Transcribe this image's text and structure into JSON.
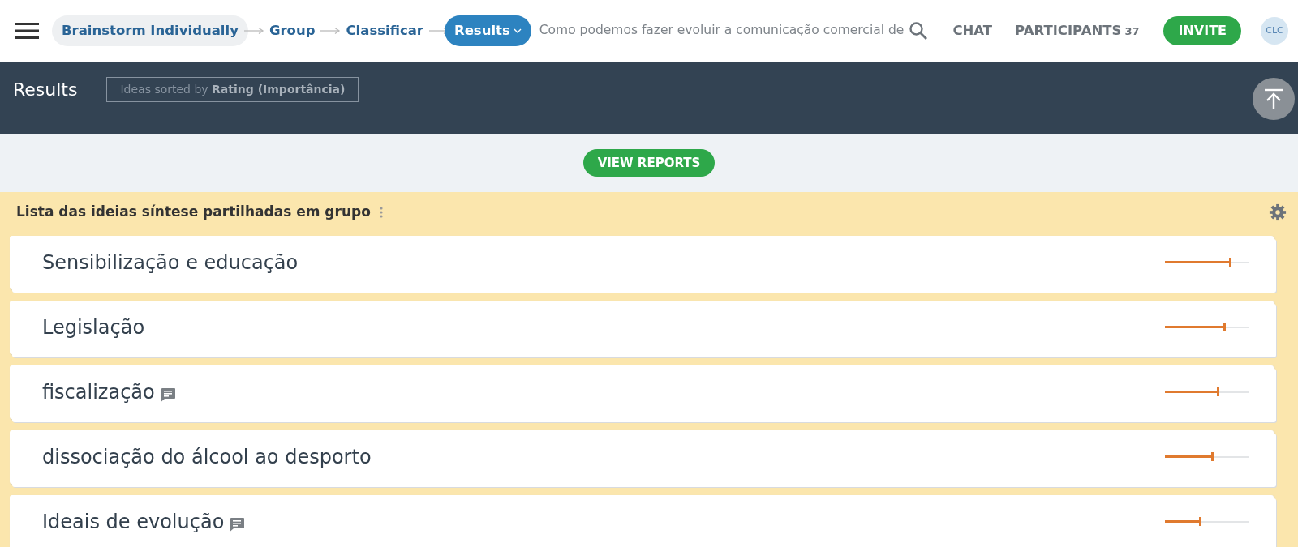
{
  "breadcrumb": [
    {
      "label": "Brainstorm Individually",
      "selected": false,
      "highlighted": true
    },
    {
      "label": "Group",
      "selected": false,
      "highlighted": false
    },
    {
      "label": "Classificar",
      "selected": false,
      "highlighted": false
    },
    {
      "label": "Results",
      "selected": true,
      "highlighted": false
    }
  ],
  "question": "Como podemos fazer evoluir a comunicação comercial de",
  "nav": {
    "chat": "CHAT",
    "participants": "PARTICIPANTS",
    "participants_count": "37",
    "invite": "INVITE",
    "avatar": "CLC"
  },
  "header": {
    "title": "Results",
    "sort_label": "Ideas sorted by **Rating (Importância)**"
  },
  "view_reports": "VIEW REPORTS",
  "list": {
    "title": "Lista das ideias síntese partilhadas em grupo",
    "ideas": [
      {
        "text": "Sensibilização e educação",
        "has_comments": false,
        "level": 0.78
      },
      {
        "text": "Legislação",
        "has_comments": false,
        "level": 0.71
      },
      {
        "text": "fiscalização",
        "has_comments": true,
        "level": 0.63
      },
      {
        "text": "dissociação do álcool ao desporto",
        "has_comments": false,
        "level": 0.57
      },
      {
        "text": "Ideais de evolução",
        "has_comments": true,
        "level": 0.42
      }
    ]
  }
}
